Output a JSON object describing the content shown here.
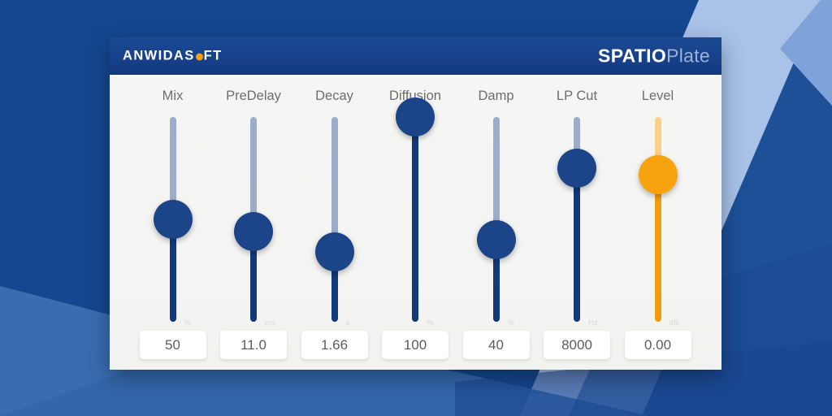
{
  "window": {
    "vendor_logo_pre": "ANWIDAS",
    "vendor_logo_post": "FT",
    "vendor_logo_full": "ANWIDASOFT",
    "product_bold": "SPATIO",
    "product_light": "Plate"
  },
  "colors": {
    "background_blue": "#14478f",
    "titlebar_blue": "#17418a",
    "panel_grey": "#f4f4f3",
    "track_inactive": "#9cadc9",
    "track_active": "#13397a",
    "knob_blue": "#1c4489",
    "accent_orange": "#f6a30f",
    "accent_track_inactive": "#fcd089",
    "label_grey": "#6d6d6d",
    "value_grey": "#5c5c5c"
  },
  "controls": [
    {
      "name": "Mix",
      "value": "50",
      "unit": "%",
      "percent": 50,
      "accent": false
    },
    {
      "name": "PreDelay",
      "value": "11.0",
      "unit": "ms",
      "percent": 44,
      "accent": false
    },
    {
      "name": "Decay",
      "value": "1.66",
      "unit": "s",
      "percent": 34,
      "accent": false
    },
    {
      "name": "Diffusion",
      "value": "100",
      "unit": "%",
      "percent": 100,
      "accent": false
    },
    {
      "name": "Damp",
      "value": "40",
      "unit": "%",
      "percent": 40,
      "accent": false
    },
    {
      "name": "LP Cut",
      "value": "8000",
      "unit": "Hz",
      "percent": 75,
      "accent": false
    },
    {
      "name": "Level",
      "value": "0.00",
      "unit": "dB",
      "percent": 72,
      "accent": true
    }
  ]
}
